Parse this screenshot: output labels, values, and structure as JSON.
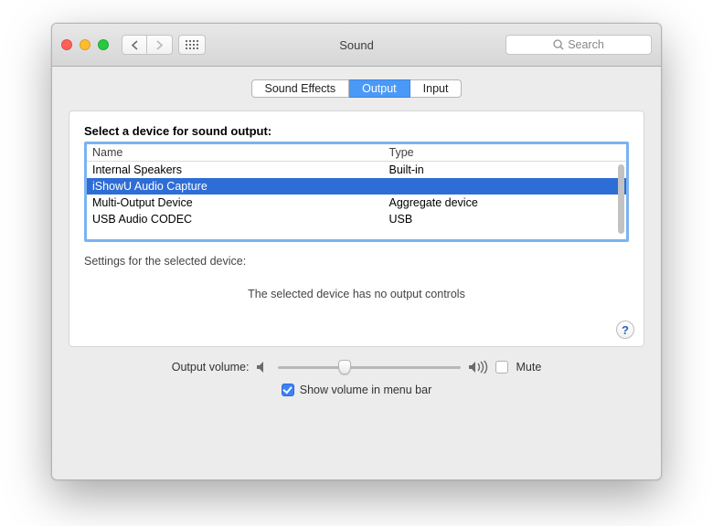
{
  "window": {
    "title": "Sound"
  },
  "toolbar": {
    "search_placeholder": "Search"
  },
  "tabs": {
    "effects": "Sound Effects",
    "output": "Output",
    "input": "Input",
    "active": "output"
  },
  "output_panel": {
    "heading": "Select a device for sound output:",
    "columns": {
      "name": "Name",
      "type": "Type"
    },
    "devices": [
      {
        "name": "Internal Speakers",
        "type": "Built-in",
        "selected": false
      },
      {
        "name": "iShowU Audio Capture",
        "type": "",
        "selected": true
      },
      {
        "name": "Multi-Output Device",
        "type": "Aggregate device",
        "selected": false
      },
      {
        "name": "USB Audio CODEC",
        "type": "USB",
        "selected": false
      }
    ],
    "settings_label": "Settings for the selected device:",
    "no_controls": "The selected device has no output controls"
  },
  "footer": {
    "volume_label": "Output volume:",
    "mute_label": "Mute",
    "mute_checked": false,
    "show_menu_label": "Show volume in menu bar",
    "show_menu_checked": true,
    "volume_value": 0.35
  },
  "help_glyph": "?"
}
